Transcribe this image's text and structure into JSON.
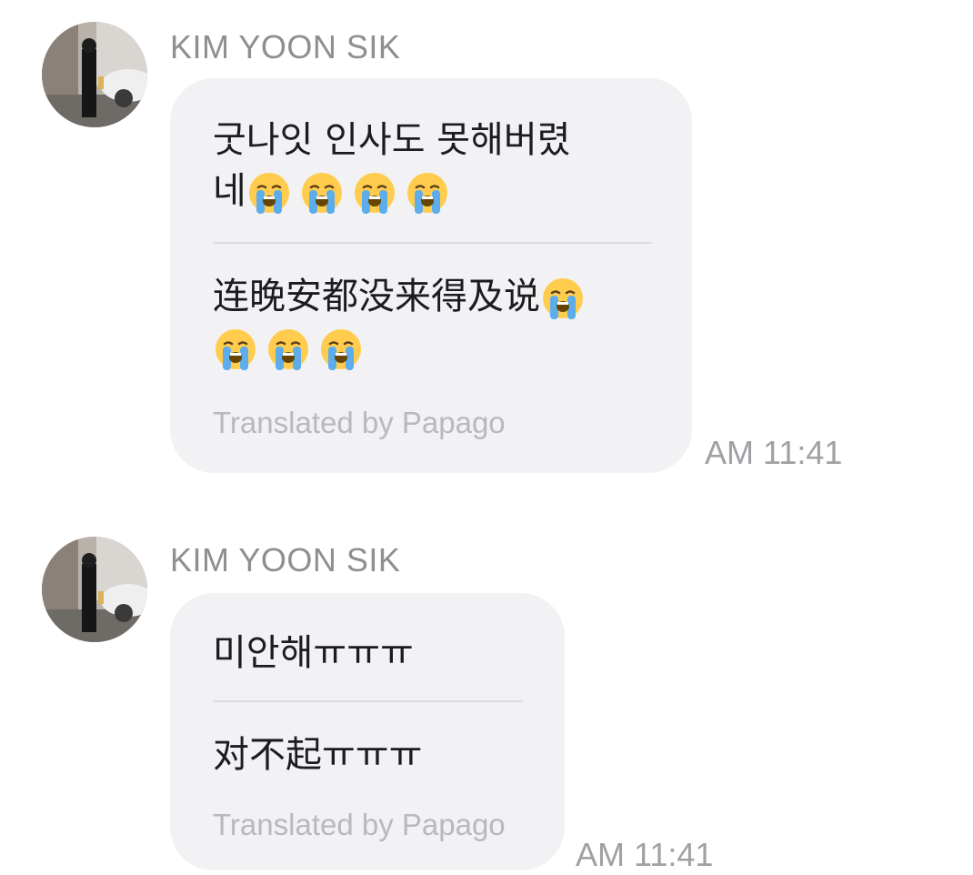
{
  "messages": [
    {
      "sender": "KIM YOON SIK",
      "original_text": "굿나잇 인사도 못해버렸",
      "original_line2": "네",
      "original_emoji_count": 4,
      "translated_text": "连晚安都没来得及说",
      "translated_emoji_line1_count": 1,
      "translated_emoji_line2_count": 3,
      "credit": "Translated by Papago",
      "time": "AM 11:41"
    },
    {
      "sender": "KIM YOON SIK",
      "original_text": "미안해ㅠㅠㅠ",
      "translated_text": "对不起ㅠㅠㅠ",
      "credit": "Translated by Papago",
      "time": "AM 11:41"
    }
  ],
  "icons": {
    "avatar": "profile-photo",
    "emoji": "loudly-crying-face"
  },
  "colors": {
    "bubble": "#f2f2f5",
    "sender": "#8e8e93",
    "time": "#a0a0a5",
    "credit": "#b8b8bd"
  }
}
